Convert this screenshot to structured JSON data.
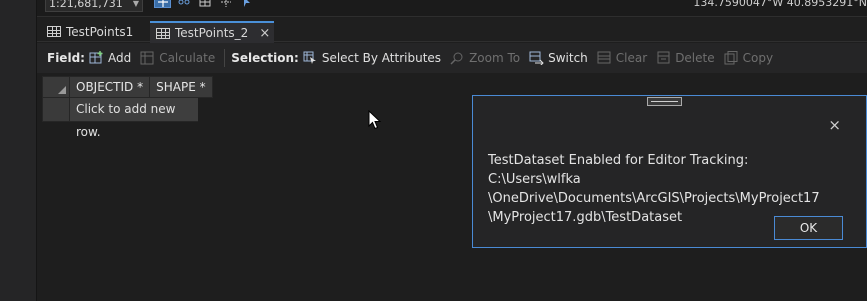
{
  "topbar": {
    "scale": "1:21,681,731",
    "coords": "134.7590047°W 40.8953291°N"
  },
  "tabs": [
    {
      "label": "TestPoints1"
    },
    {
      "label": "TestPoints_2",
      "close": "×"
    }
  ],
  "toolbar": {
    "field_label": "Field:",
    "add": "Add",
    "calculate": "Calculate",
    "selection_label": "Selection:",
    "select_by_attributes": "Select By Attributes",
    "zoom_to": "Zoom To",
    "switch": "Switch",
    "clear": "Clear",
    "delete": "Delete",
    "copy": "Copy"
  },
  "table": {
    "columns": [
      "OBJECTID *",
      "SHAPE *"
    ],
    "new_row_text": "Click to add new row."
  },
  "dialog": {
    "close": "×",
    "message_lines": [
      "TestDataset Enabled for Editor Tracking: C:\\Users\\wlfka",
      "\\OneDrive\\Documents\\ArcGIS\\Projects\\MyProject17",
      "\\MyProject17.gdb\\TestDataset"
    ],
    "ok": "OK"
  },
  "colors": {
    "accent": "#4a8ad4",
    "background": "#1e1e1e",
    "panel": "#252526"
  },
  "icons": [
    "grid-icon",
    "add-field-icon",
    "calculate-icon",
    "select-by-attributes-icon",
    "zoom-to-icon",
    "switch-icon",
    "clear-icon",
    "delete-icon",
    "copy-icon",
    "close-icon",
    "mouse-cursor-icon"
  ]
}
